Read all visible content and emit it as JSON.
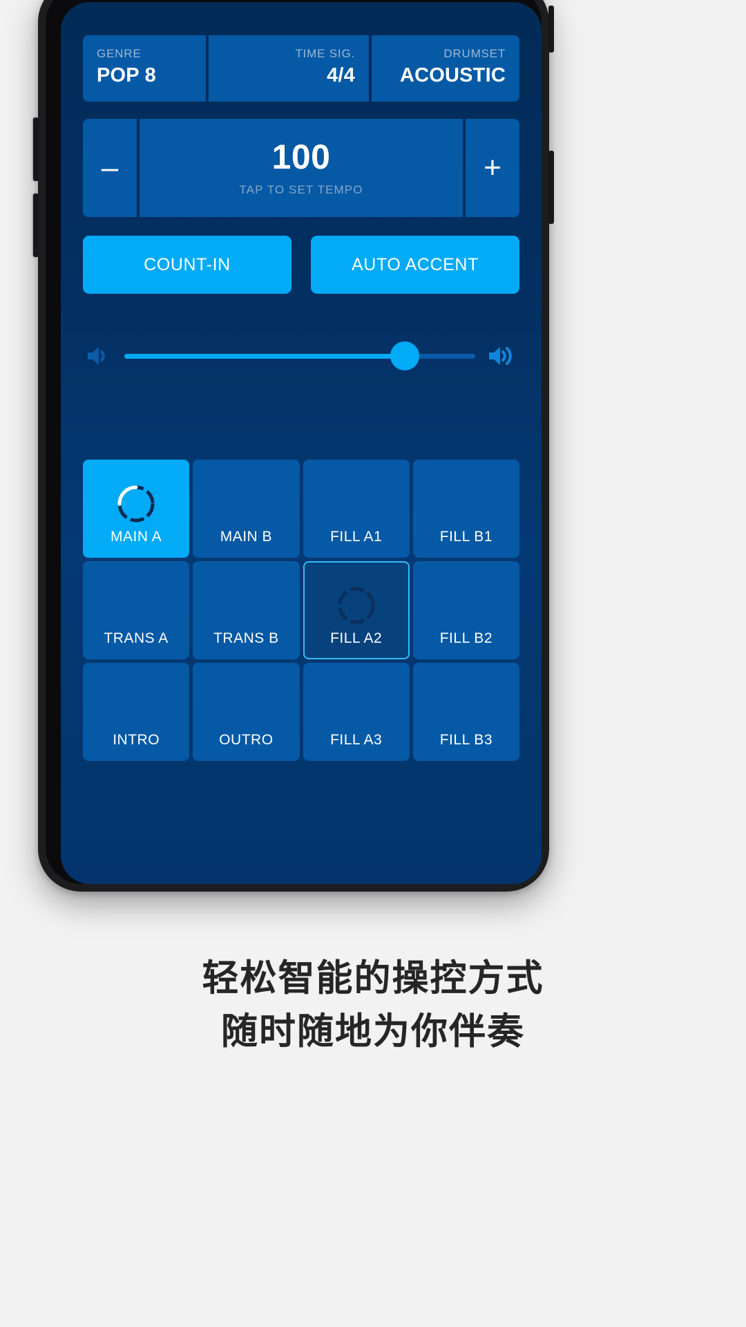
{
  "app": {
    "info_bar": {
      "genre": {
        "label": "GENRE",
        "value": "POP 8"
      },
      "time_signature": {
        "label": "TIME SIG.",
        "value": "4/4"
      },
      "drumset": {
        "label": "DRUMSET",
        "value": "ACOUSTIC"
      }
    },
    "tempo": {
      "decrease_label": "–",
      "increase_label": "+",
      "value": "100",
      "hint": "TAP TO SET TEMPO"
    },
    "toggles": {
      "count_in_label": "COUNT-IN",
      "auto_accent_label": "AUTO ACCENT"
    },
    "volume": {
      "low_icon": "speaker-low-icon",
      "high_icon": "speaker-high-icon",
      "level_percent": 80
    },
    "pads": [
      {
        "label": "MAIN A",
        "state": "active",
        "dial": true
      },
      {
        "label": "MAIN B",
        "state": "idle",
        "dial": false
      },
      {
        "label": "FILL A1",
        "state": "idle",
        "dial": false
      },
      {
        "label": "FILL B1",
        "state": "idle",
        "dial": false
      },
      {
        "label": "TRANS A",
        "state": "idle",
        "dial": false
      },
      {
        "label": "TRANS B",
        "state": "idle",
        "dial": false
      },
      {
        "label": "FILL A2",
        "state": "queued",
        "dial": true
      },
      {
        "label": "FILL B2",
        "state": "idle",
        "dial": false
      },
      {
        "label": "INTRO",
        "state": "idle",
        "dial": false
      },
      {
        "label": "OUTRO",
        "state": "idle",
        "dial": false
      },
      {
        "label": "FILL A3",
        "state": "idle",
        "dial": false
      },
      {
        "label": "FILL B3",
        "state": "idle",
        "dial": false
      }
    ]
  },
  "caption": {
    "line1": "轻松智能的操控方式",
    "line2": "随时随地为你伴奏"
  },
  "colors": {
    "screen_bg_top": "#022b57",
    "screen_bg_bottom": "#04346b",
    "panel": "#0659a5",
    "accent": "#03aaf6",
    "queued_border": "#35bcfb",
    "queued_bg": "#07427c",
    "muted_text": "#9db9d4",
    "caption_text": "#262626"
  }
}
